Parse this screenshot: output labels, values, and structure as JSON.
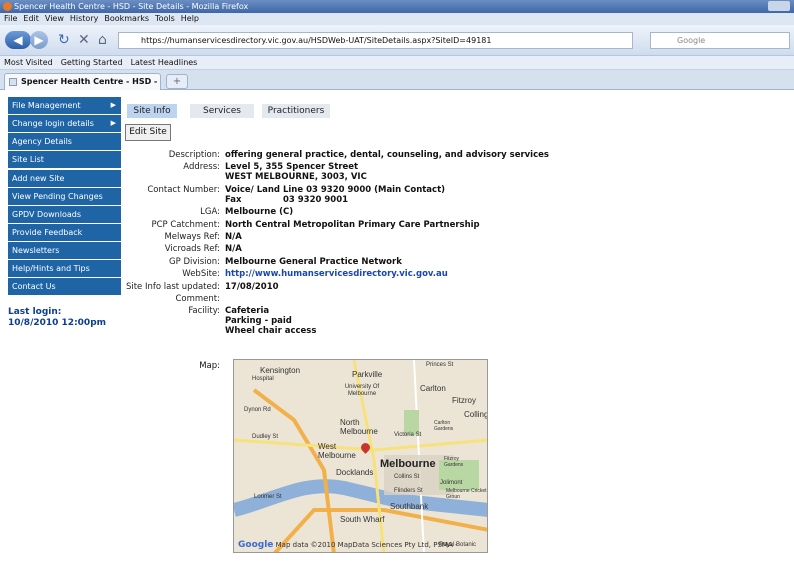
{
  "window": {
    "title": "Spencer Health Centre - HSD - Site Details - Mozilla Firefox"
  },
  "menu": [
    "File",
    "Edit",
    "View",
    "History",
    "Bookmarks",
    "Tools",
    "Help"
  ],
  "nav": {
    "url": "https://humanservicesdirectory.vic.gov.au/HSDWeb-UAT/SiteDetails.aspx?SiteID=49181",
    "search_placeholder": "Google"
  },
  "bookmarks": [
    "Most Visited",
    "Getting Started",
    "Latest Headlines"
  ],
  "browser_tab": {
    "title": "Spencer Health Centre - HSD - Site ...",
    "new_tab": "+"
  },
  "sidebar": {
    "items": [
      {
        "label": "File Management",
        "arrow": "▶"
      },
      {
        "label": "Change login details",
        "arrow": "▶"
      },
      {
        "label": "Agency Details"
      },
      {
        "label": "Site List"
      },
      {
        "label": "Add new Site"
      },
      {
        "label": "View Pending Changes"
      },
      {
        "label": "GPDV Downloads"
      },
      {
        "label": "Provide Feedback"
      },
      {
        "label": "Newsletters"
      },
      {
        "label": "Help/Hints and Tips"
      },
      {
        "label": "Contact Us"
      }
    ],
    "last_login_label": "Last login:",
    "last_login_value": "10/8/2010 12:00pm"
  },
  "page_tabs": [
    "Site Info",
    "Services",
    "Practitioners"
  ],
  "edit_site_label": "Edit Site",
  "details": [
    {
      "label": "Description:",
      "value": "offering general practice, dental, counseling, and advisory services"
    },
    {
      "label": "Address:",
      "lines": [
        "Level 5, 355 Spencer Street",
        "WEST MELBOURNE, 3003, VIC"
      ]
    },
    {
      "label": "Contact Number:",
      "lines": [
        "Voice/ Land Line 03 9320 9000 (Main Contact)",
        "Fax              03 9320 9001"
      ]
    },
    {
      "label": "LGA:",
      "value": "Melbourne (C)"
    },
    {
      "label": "PCP Catchment:",
      "value": "North Central Metropolitan Primary Care Partnership"
    },
    {
      "label": "Melways Ref:",
      "value": "N/A"
    },
    {
      "label": "Vicroads Ref:",
      "value": "N/A"
    },
    {
      "label": "GP Division:",
      "value": "Melbourne General Practice Network"
    },
    {
      "label": "WebSite:",
      "value": "http://www.humanservicesdirectory.vic.gov.au",
      "link": true
    },
    {
      "label": "Site Info last updated:",
      "value": "17/08/2010"
    },
    {
      "label": "Comment:",
      "value": ""
    },
    {
      "label": "Facility:",
      "lines": [
        "Cafeteria",
        "Parking - paid",
        "Wheel chair access"
      ]
    }
  ],
  "map": {
    "label": "Map:",
    "places": [
      "Kensington",
      "Parkville",
      "University Of Melbourne",
      "Carlton",
      "Fitzroy",
      "Colling",
      "North Melbourne",
      "West Melbourne",
      "Melbourne",
      "Docklands",
      "South Wharf",
      "Southbank",
      "Princes St",
      "Dynon Rd",
      "Victoria St",
      "Carlton Gardens",
      "Fitzroy Gardens",
      "Jolimont",
      "Melbourne Cricket Groun",
      "Flinders St",
      "Collins St",
      "Lorimer St",
      "Dudley St",
      "Royal Botanic",
      "Hospital"
    ],
    "copyright": "Map data ©2010 MapData Sciences Pty Ltd, PSMA - ",
    "logo": "Google"
  }
}
